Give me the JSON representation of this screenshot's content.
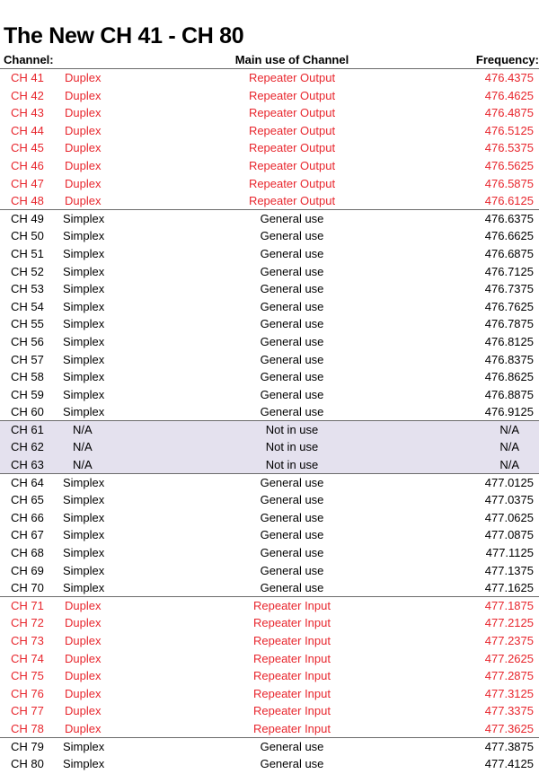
{
  "title": "The New CH 41 - CH 80",
  "header": {
    "channel": "Channel:",
    "main_use": "Main use of Channel",
    "frequency": "Frequency:"
  },
  "colors": {
    "repeater_text": "#e8262d",
    "not_in_use_bg": "#e4e1ee",
    "rule": "#6b6b6b"
  },
  "rows": [
    {
      "channel": "CH 41",
      "type": "Duplex",
      "use": "Repeater Output",
      "frequency": "476.4375",
      "group": "repeater"
    },
    {
      "channel": "CH 42",
      "type": "Duplex",
      "use": "Repeater Output",
      "frequency": "476.4625",
      "group": "repeater"
    },
    {
      "channel": "CH 43",
      "type": "Duplex",
      "use": "Repeater Output",
      "frequency": "476.4875",
      "group": "repeater"
    },
    {
      "channel": "CH 44",
      "type": "Duplex",
      "use": "Repeater Output",
      "frequency": "476.5125",
      "group": "repeater"
    },
    {
      "channel": "CH 45",
      "type": "Duplex",
      "use": "Repeater Output",
      "frequency": "476.5375",
      "group": "repeater"
    },
    {
      "channel": "CH 46",
      "type": "Duplex",
      "use": "Repeater Output",
      "frequency": "476.5625",
      "group": "repeater"
    },
    {
      "channel": "CH 47",
      "type": "Duplex",
      "use": "Repeater Output",
      "frequency": "476.5875",
      "group": "repeater"
    },
    {
      "channel": "CH 48",
      "type": "Duplex",
      "use": "Repeater Output",
      "frequency": "476.6125",
      "group": "repeater",
      "separator": true
    },
    {
      "channel": "CH 49",
      "type": "Simplex",
      "use": "General use",
      "frequency": "476.6375",
      "group": "general"
    },
    {
      "channel": "CH 50",
      "type": "Simplex",
      "use": "General use",
      "frequency": "476.6625",
      "group": "general"
    },
    {
      "channel": "CH 51",
      "type": "Simplex",
      "use": "General use",
      "frequency": "476.6875",
      "group": "general"
    },
    {
      "channel": "CH 52",
      "type": "Simplex",
      "use": "General use",
      "frequency": "476.7125",
      "group": "general"
    },
    {
      "channel": "CH 53",
      "type": "Simplex",
      "use": "General use",
      "frequency": "476.7375",
      "group": "general"
    },
    {
      "channel": "CH 54",
      "type": "Simplex",
      "use": "General use",
      "frequency": "476.7625",
      "group": "general"
    },
    {
      "channel": "CH 55",
      "type": "Simplex",
      "use": "General use",
      "frequency": "476.7875",
      "group": "general"
    },
    {
      "channel": "CH 56",
      "type": "Simplex",
      "use": "General use",
      "frequency": "476.8125",
      "group": "general"
    },
    {
      "channel": "CH 57",
      "type": "Simplex",
      "use": "General use",
      "frequency": "476.8375",
      "group": "general"
    },
    {
      "channel": "CH 58",
      "type": "Simplex",
      "use": "General use",
      "frequency": "476.8625",
      "group": "general"
    },
    {
      "channel": "CH 59",
      "type": "Simplex",
      "use": "General use",
      "frequency": "476.8875",
      "group": "general"
    },
    {
      "channel": "CH 60",
      "type": "Simplex",
      "use": "General use",
      "frequency": "476.9125",
      "group": "general",
      "separator": true
    },
    {
      "channel": "CH 61",
      "type": "N/A",
      "use": "Not in use",
      "frequency": "N/A",
      "group": "na"
    },
    {
      "channel": "CH 62",
      "type": "N/A",
      "use": "Not in use",
      "frequency": "N/A",
      "group": "na"
    },
    {
      "channel": "CH 63",
      "type": "N/A",
      "use": "Not in use",
      "frequency": "N/A",
      "group": "na",
      "separator": true
    },
    {
      "channel": "CH 64",
      "type": "Simplex",
      "use": "General use",
      "frequency": "477.0125",
      "group": "general"
    },
    {
      "channel": "CH 65",
      "type": "Simplex",
      "use": "General use",
      "frequency": "477.0375",
      "group": "general"
    },
    {
      "channel": "CH 66",
      "type": "Simplex",
      "use": "General use",
      "frequency": "477.0625",
      "group": "general"
    },
    {
      "channel": "CH 67",
      "type": "Simplex",
      "use": "General use",
      "frequency": "477.0875",
      "group": "general"
    },
    {
      "channel": "CH 68",
      "type": "Simplex",
      "use": "General use",
      "frequency": "477.1125",
      "group": "general"
    },
    {
      "channel": "CH 69",
      "type": "Simplex",
      "use": "General use",
      "frequency": "477.1375",
      "group": "general"
    },
    {
      "channel": "CH 70",
      "type": "Simplex",
      "use": "General use",
      "frequency": "477.1625",
      "group": "general",
      "separator": true
    },
    {
      "channel": "CH 71",
      "type": "Duplex",
      "use": "Repeater Input",
      "frequency": "477.1875",
      "group": "repeater"
    },
    {
      "channel": "CH 72",
      "type": "Duplex",
      "use": "Repeater Input",
      "frequency": "477.2125",
      "group": "repeater"
    },
    {
      "channel": "CH 73",
      "type": "Duplex",
      "use": "Repeater Input",
      "frequency": "477.2375",
      "group": "repeater"
    },
    {
      "channel": "CH 74",
      "type": "Duplex",
      "use": "Repeater Input",
      "frequency": "477.2625",
      "group": "repeater"
    },
    {
      "channel": "CH 75",
      "type": "Duplex",
      "use": "Repeater Input",
      "frequency": "477.2875",
      "group": "repeater"
    },
    {
      "channel": "CH 76",
      "type": "Duplex",
      "use": "Repeater Input",
      "frequency": "477.3125",
      "group": "repeater"
    },
    {
      "channel": "CH 77",
      "type": "Duplex",
      "use": "Repeater Input",
      "frequency": "477.3375",
      "group": "repeater"
    },
    {
      "channel": "CH 78",
      "type": "Duplex",
      "use": "Repeater Input",
      "frequency": "477.3625",
      "group": "repeater",
      "separator": true
    },
    {
      "channel": "CH 79",
      "type": "Simplex",
      "use": "General use",
      "frequency": "477.3875",
      "group": "general"
    },
    {
      "channel": "CH 80",
      "type": "Simplex",
      "use": "General use",
      "frequency": "477.4125",
      "group": "general"
    }
  ]
}
